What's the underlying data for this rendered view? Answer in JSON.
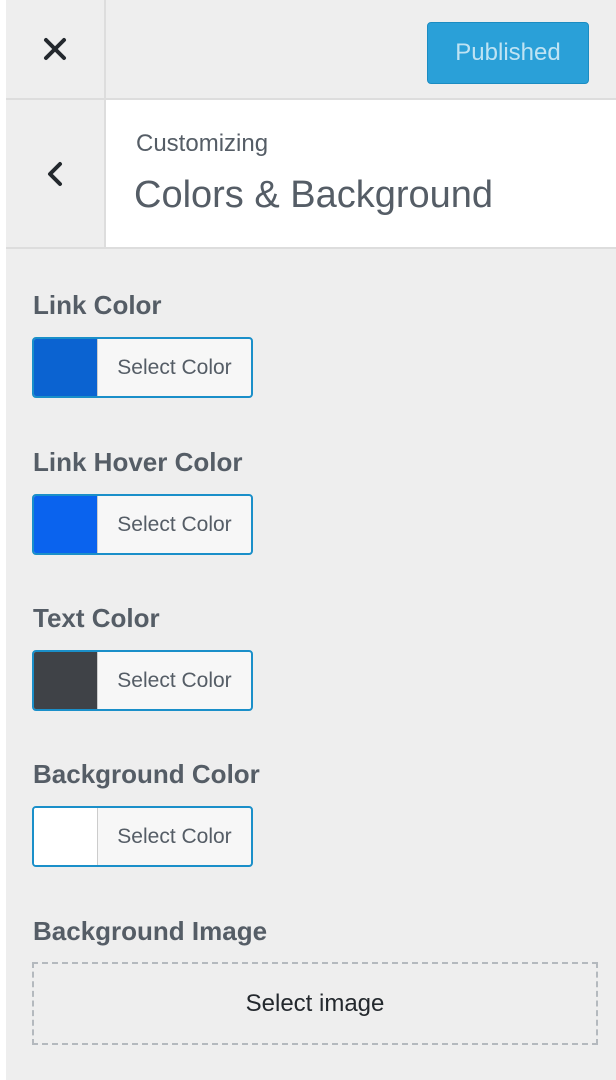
{
  "header": {
    "close_icon": "close-icon",
    "publish_label": "Published"
  },
  "section": {
    "back_icon": "chevron-left-icon",
    "subtitle": "Customizing",
    "title": "Colors & Background"
  },
  "controls": [
    {
      "label": "Link Color",
      "button_label": "Select Color",
      "color": "#0b63d1"
    },
    {
      "label": "Link Hover Color",
      "button_label": "Select Color",
      "color": "#0a63ee"
    },
    {
      "label": "Text Color",
      "button_label": "Select Color",
      "color": "#3f4247"
    },
    {
      "label": "Background Color",
      "button_label": "Select Color",
      "color": "#ffffff"
    }
  ],
  "background_image": {
    "label": "Background Image",
    "button_label": "Select image"
  },
  "colors": {
    "accent": "#2aa0d8",
    "panel_bg": "#eeeeee",
    "picker_border": "#1a8fc9"
  }
}
